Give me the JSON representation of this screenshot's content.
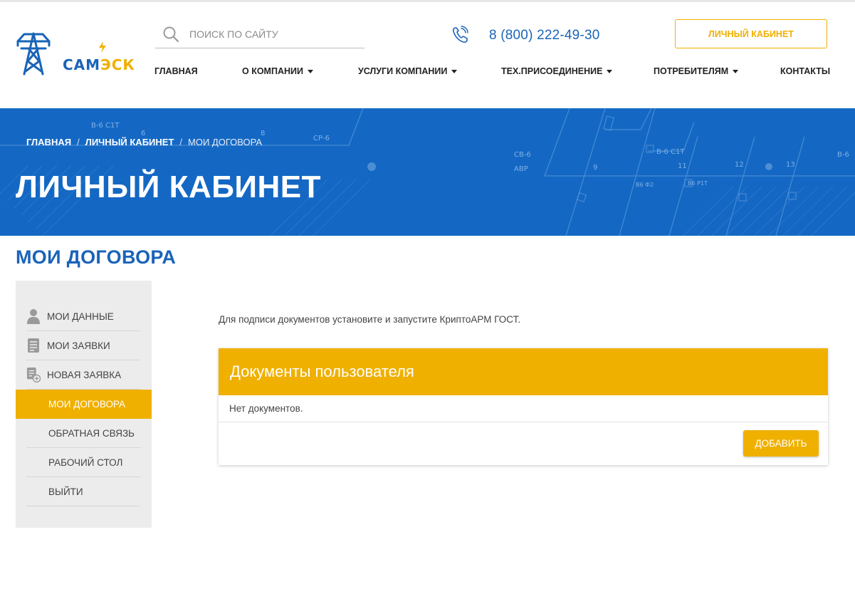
{
  "brand": {
    "logo_part1": "САМ",
    "logo_part2": "ЭСК",
    "primary_color": "#1a64b8",
    "accent_color": "#f0b000"
  },
  "search": {
    "placeholder": "Поиск по сайту",
    "value": ""
  },
  "header": {
    "phone": "8 (800) 222-49-30",
    "cabinet_button": "Личный кабинет"
  },
  "nav": {
    "items": [
      {
        "label": "ГЛАВНАЯ",
        "dropdown": false
      },
      {
        "label": "О КОМПАНИИ",
        "dropdown": true
      },
      {
        "label": "УСЛУГИ КОМПАНИИ",
        "dropdown": true
      },
      {
        "label": "ТЕХ.ПРИСОЕДИНЕНИЕ",
        "dropdown": true
      },
      {
        "label": "ПОТРЕБИТЕЛЯМ",
        "dropdown": true
      },
      {
        "label": "КОНТАКТЫ",
        "dropdown": false
      }
    ]
  },
  "breadcrumb": {
    "items": [
      "ГЛАВНАЯ",
      "ЛИЧНЫЙ КАБИНЕТ",
      "МОИ ДОГОВОРА"
    ],
    "separator": "/"
  },
  "banner": {
    "title": "ЛИЧНЫЙ КАБИНЕТ",
    "diagram_labels": [
      "В-6 С1Т",
      "СР-6",
      "СВ-6",
      "АВР",
      "В-6 С1Т",
      "9",
      "11",
      "12",
      "13",
      "В-6",
      "6",
      "8",
      "В6 Ф2",
      "В6 Р1Т"
    ]
  },
  "page": {
    "title": "МОИ ДОГОВОРА"
  },
  "sidebar": {
    "items": [
      {
        "label": "Мои данные",
        "icon": "user-icon"
      },
      {
        "label": "Мои заявки",
        "icon": "document-list-icon"
      },
      {
        "label": "Новая заявка",
        "icon": "new-document-icon"
      },
      {
        "label": "Мои договора",
        "icon": "",
        "active": true
      },
      {
        "label": "Обратная связь",
        "icon": ""
      },
      {
        "label": "Рабочий стол",
        "icon": ""
      },
      {
        "label": "Выйти",
        "icon": ""
      }
    ]
  },
  "main": {
    "notice": "Для подписи документов установите и запустите КриптоАРМ ГОСТ.",
    "panel_title": "Документы пользователя",
    "empty_text": "Нет документов.",
    "add_button": "Добавить"
  }
}
